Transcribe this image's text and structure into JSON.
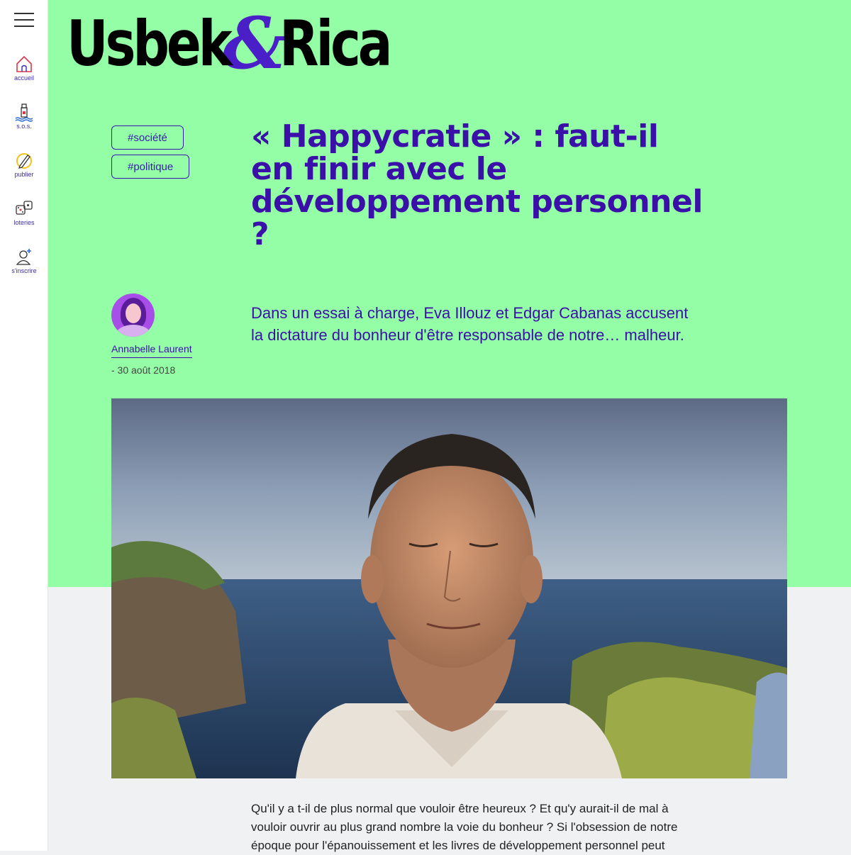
{
  "nav": {
    "items": [
      {
        "label": "accueil",
        "icon": "home-icon"
      },
      {
        "label": "s.o.s.",
        "icon": "bottle-icon"
      },
      {
        "label": "publier",
        "icon": "pencil-icon"
      },
      {
        "label": "loteries",
        "icon": "dice-icon"
      },
      {
        "label": "s'inscrire",
        "icon": "user-add-icon"
      }
    ]
  },
  "brand": {
    "name_left": "Usbek",
    "name_amp": "&",
    "name_right": "Rica"
  },
  "article": {
    "tags": [
      "#société",
      "#politique"
    ],
    "title": "« Happycratie » : faut-il en finir avec le développement personnel ?",
    "author": "Annabelle Laurent",
    "date": "- 30 août 2018",
    "lead": "Dans un essai à charge, Eva Illouz et Edgar Cabanas accusent la dictature du bonheur d'être responsable de notre… malheur.",
    "body": "Qu'il y a t-il de plus normal que vouloir être heureux ? Et qu'y aurait-il de mal à vouloir ouvrir au plus grand nombre la voie du bonheur ? Si l'obsession de notre époque pour l'épanouissement et les livres de développement personnel peut"
  },
  "colors": {
    "green": "#94fea6",
    "purple": "#3a10a8",
    "accent": "#4b1fc8"
  }
}
